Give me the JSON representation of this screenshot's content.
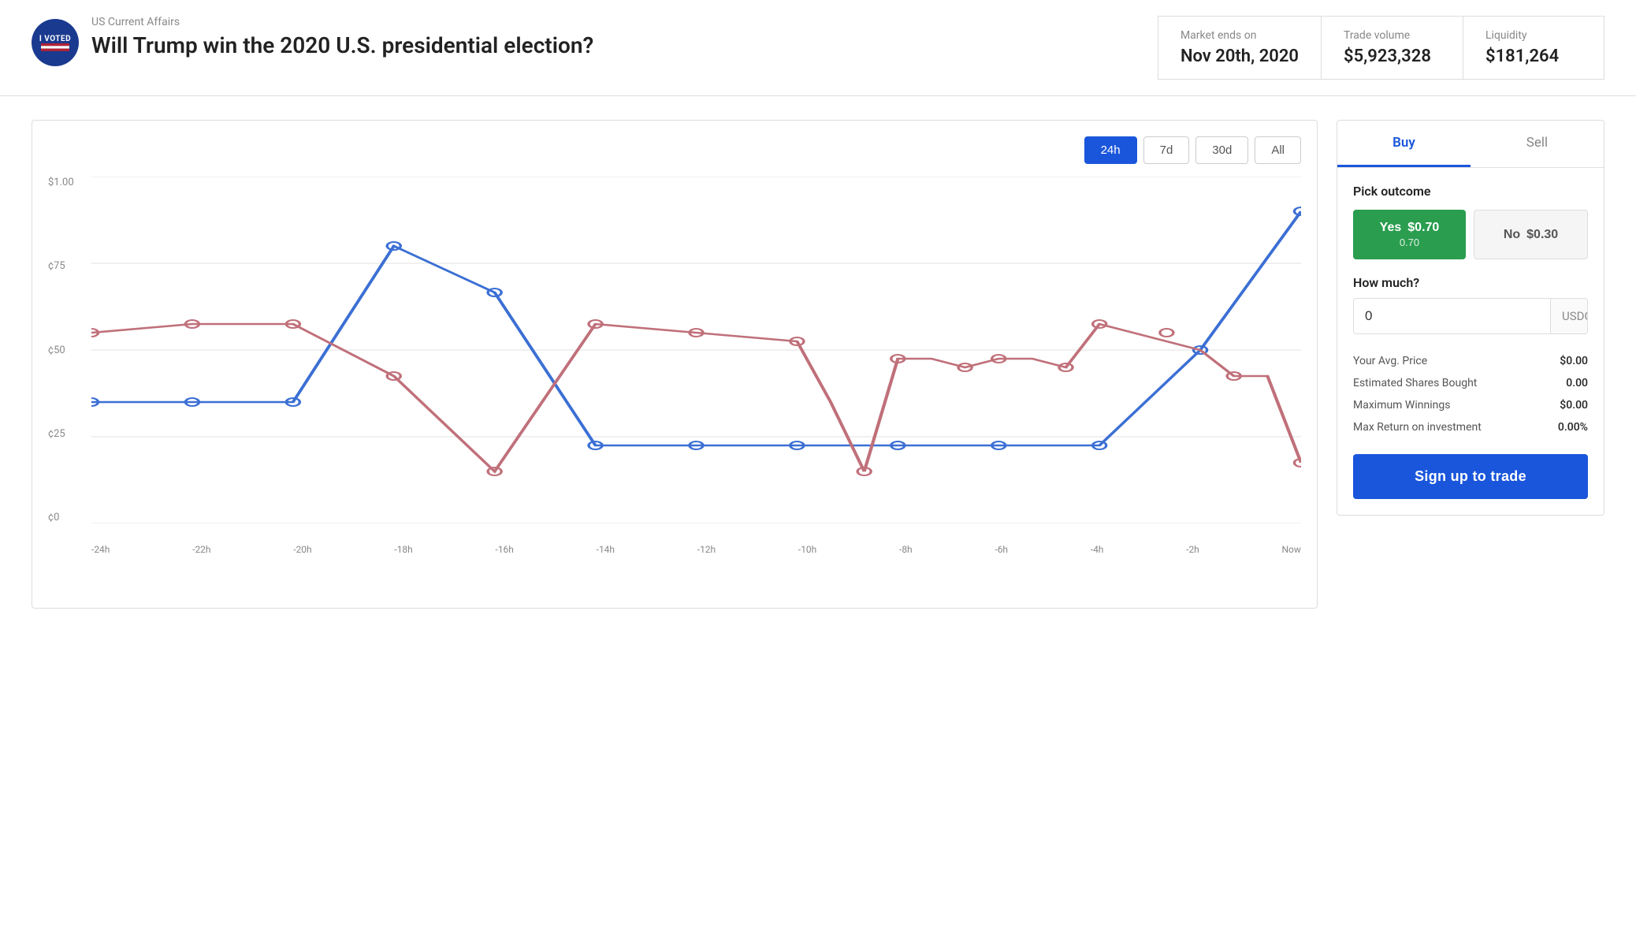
{
  "header": {
    "badge_text": "I VOTED",
    "category": "US Current Affairs",
    "title": "Will Trump win the 2020 U.S. presidential election?",
    "stats": [
      {
        "label": "Market ends on",
        "value": "Nov 20th, 2020"
      },
      {
        "label": "Trade volume",
        "value": "$5,923,328"
      },
      {
        "label": "Liquidity",
        "value": "$181,264"
      }
    ]
  },
  "chart": {
    "time_buttons": [
      {
        "label": "24h",
        "active": true
      },
      {
        "label": "7d",
        "active": false
      },
      {
        "label": "30d",
        "active": false
      },
      {
        "label": "All",
        "active": false
      }
    ],
    "y_labels": [
      "$1.00",
      "¢75",
      "¢50",
      "¢25",
      "¢0"
    ],
    "x_labels": [
      "-24h",
      "-22h",
      "-20h",
      "-18h",
      "-16h",
      "-14h",
      "-12h",
      "-10h",
      "-8h",
      "-6h",
      "-4h",
      "-2h",
      "Now"
    ]
  },
  "trade": {
    "tabs": [
      {
        "label": "Buy",
        "active": true
      },
      {
        "label": "Sell",
        "active": false
      }
    ],
    "pick_outcome_label": "Pick outcome",
    "yes_btn": {
      "title": "Yes",
      "price": "$0.70",
      "sub": "0.70"
    },
    "no_btn": {
      "title": "No",
      "price": "$0.30"
    },
    "how_much_label": "How much?",
    "amount_placeholder": "0",
    "currency": "USDC",
    "stats": [
      {
        "label": "Your Avg. Price",
        "value": "$0.00"
      },
      {
        "label": "Estimated Shares Bought",
        "value": "0.00"
      },
      {
        "label": "Maximum Winnings",
        "value": "$0.00"
      },
      {
        "label": "Max Return on investment",
        "value": "0.00%"
      }
    ],
    "cta_button": "Sign up to trade"
  }
}
